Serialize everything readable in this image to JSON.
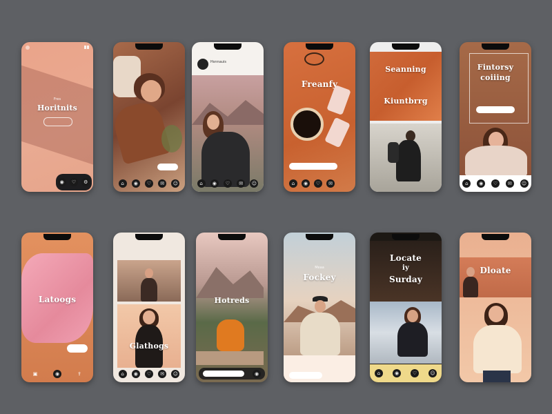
{
  "phones": [
    {
      "title": "Horitnits",
      "sub": "Fres",
      "pill": ""
    },
    {
      "title": "",
      "sub": "",
      "pill": ""
    },
    {
      "title": "",
      "sub": "",
      "pill": "",
      "header_name": "Hsnnauis"
    },
    {
      "title": "Freanfy",
      "sub": "",
      "pill": ""
    },
    {
      "title": "Seanning",
      "title2": "Kiuntbrrg",
      "pill": ""
    },
    {
      "title": "Fintorsy",
      "title2": "coiiing",
      "pill": ""
    },
    {
      "title": "Latoogs",
      "pill": ""
    },
    {
      "title": "Glathogs",
      "pill": ""
    },
    {
      "title": "Hotreds",
      "pill": ""
    },
    {
      "title": "Fockey",
      "sub": "Meaa",
      "pill": ""
    },
    {
      "title": "Locate",
      "title_mid": "iy",
      "title2": "Surday",
      "pill": ""
    },
    {
      "title": "Dloate",
      "pill": ""
    }
  ],
  "icons": {
    "nav": [
      "home-icon",
      "camera-icon",
      "heart-icon",
      "chat-icon",
      "profile-icon"
    ]
  },
  "colors": {
    "background": "#5e6064",
    "accent_peach": "#e8a58a",
    "accent_orange": "#d7703f",
    "accent_yellow": "#efd98a"
  }
}
